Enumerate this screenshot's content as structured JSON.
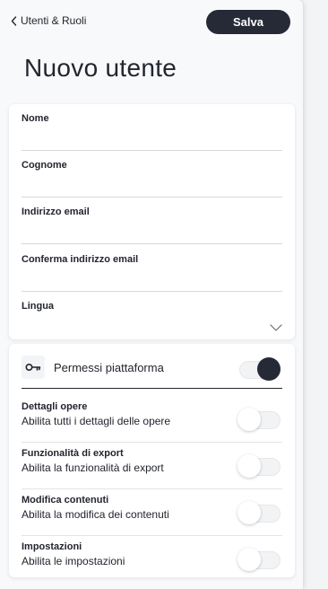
{
  "header": {
    "back_label": "Utenti & Ruoli",
    "save_label": "Salva"
  },
  "page": {
    "title": "Nuovo utente"
  },
  "form": {
    "fields": [
      {
        "label": "Nome",
        "value": ""
      },
      {
        "label": "Cognome",
        "value": ""
      },
      {
        "label": "Indirizzo email",
        "value": ""
      },
      {
        "label": "Conferma indirizzo email",
        "value": ""
      }
    ],
    "language": {
      "label": "Lingua",
      "value": ""
    }
  },
  "permissions": {
    "title": "Permessi piattaforma",
    "icon": "key-icon",
    "master_toggle_on": true,
    "items": [
      {
        "title": "Dettagli opere",
        "description": "Abilita tutti i dettagli delle opere",
        "enabled": false
      },
      {
        "title": "Funzionalità di export",
        "description": "Abilita la funzionalità di export",
        "enabled": false
      },
      {
        "title": "Modifica contenuti",
        "description": "Abilita la modifica dei contenuti",
        "enabled": false
      },
      {
        "title": "Impostazioni",
        "description": "Abilita le impostazioni",
        "enabled": false
      }
    ]
  },
  "colors": {
    "accent": "#262a36",
    "background": "#f8f9fa",
    "card": "#ffffff"
  }
}
